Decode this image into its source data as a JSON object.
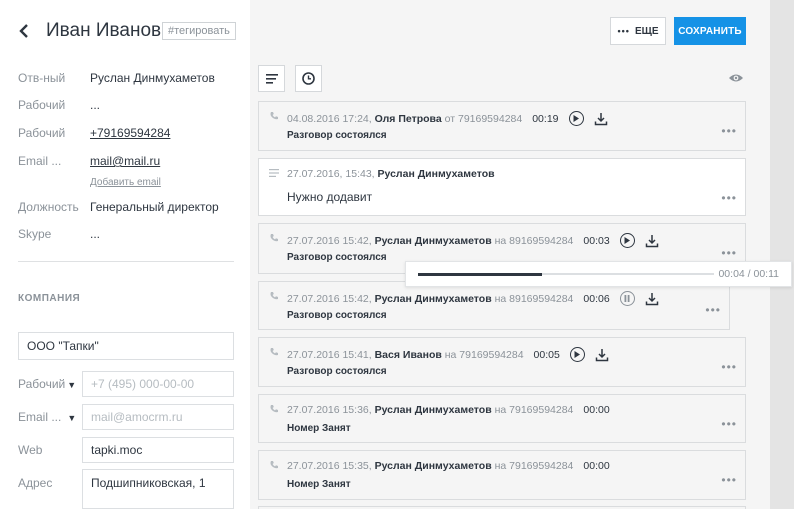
{
  "header": {
    "name": "Иван Иванов",
    "tag": "#тегировать",
    "more_label": "ЕЩЕ",
    "save_label": "СОХРАНИТЬ"
  },
  "contact_fields": [
    {
      "label": "Отв-ный",
      "value": "Руслан Динмухаметов"
    },
    {
      "label": "Рабочий",
      "value": "..."
    },
    {
      "label": "Рабочий",
      "value": "+79169594284"
    },
    {
      "label": "Email ...",
      "value": "mail@mail.ru",
      "extra": "Добавить email"
    },
    {
      "label": "Должность",
      "value": "Генеральный директор"
    },
    {
      "label": "Skype",
      "value": "..."
    }
  ],
  "company": {
    "heading": "КОМПАНИЯ",
    "name": "ООО \"Тапки\"",
    "phone_label": "Рабочий",
    "phone_placeholder": "+7 (495) 000-00-00",
    "email_label": "Email ...",
    "email_placeholder": "mail@amocrm.ru",
    "web_label": "Web",
    "web_value": "tapki.moc",
    "address_label": "Адрес",
    "address_value": "Подшипниковская, 1"
  },
  "feed": [
    {
      "type": "call",
      "date": "04.08.2016 17:24,",
      "author": "Оля Петрова",
      "dir": "от 79169594284",
      "duration": "00:19",
      "player": true,
      "status": "Разговор состоялся"
    },
    {
      "type": "note",
      "date": "27.07.2016, 15:43,",
      "author": "Руслан Динмухаметов",
      "text": "Нужно додавит"
    },
    {
      "type": "call",
      "date": "27.07.2016 15:42,",
      "author": "Руслан Динмухаметов",
      "dir": "на 89169594284",
      "duration": "00:03",
      "player": true,
      "status": "Разговор состоялся"
    },
    {
      "type": "call",
      "date": "27.07.2016 15:42,",
      "author": "Руслан Динмухаметов",
      "dir": "на 89169594284",
      "duration": "00:06",
      "player": true,
      "status": "Разговор состоялся"
    },
    {
      "type": "call",
      "date": "27.07.2016 15:41,",
      "author": "Вася Иванов",
      "dir": "на 79169594284",
      "duration": "00:05",
      "player": true,
      "status": "Разговор состоялся"
    },
    {
      "type": "call",
      "date": "27.07.2016 15:36,",
      "author": "Руслан Динмухаметов",
      "dir": "на 79169594284",
      "duration": "00:00",
      "player": false,
      "status": "Номер Занят"
    },
    {
      "type": "call",
      "date": "27.07.2016 15:35,",
      "author": "Руслан Динмухаметов",
      "dir": "на 79169594284",
      "duration": "00:00",
      "player": false,
      "status": "Номер Занят"
    }
  ],
  "audio_player": {
    "time": "00:04 / 00:11",
    "progress": 0.42
  },
  "colors": {
    "accent": "#1592e6",
    "text": "#2e3640",
    "muted": "#8b9299"
  }
}
